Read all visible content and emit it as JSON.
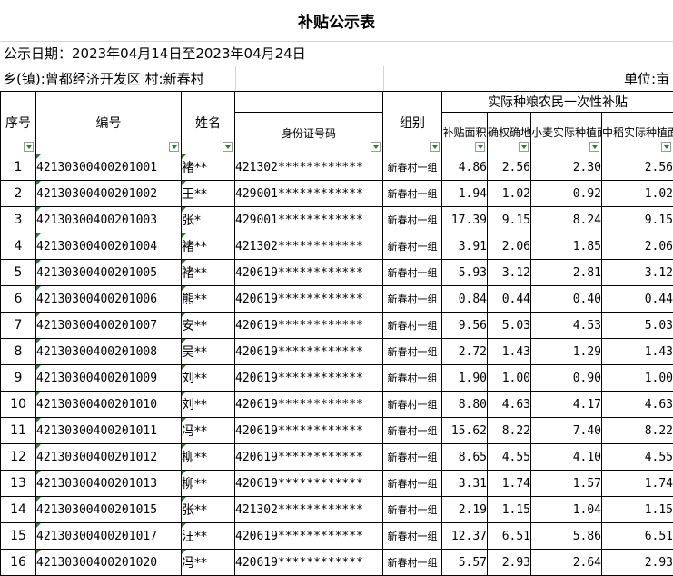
{
  "title": "补贴公示表",
  "publish_line": "公示日期：2023年04月14日至2023年04月24日",
  "location_line": "乡(镇):曾都经济开发区 村:新春村",
  "unit_line": "单位:亩",
  "headers": {
    "seq": "序号",
    "code": "编号",
    "name": "姓名",
    "id": "身份证号码",
    "group": "组别",
    "group_title": "实际种粮农民一次性补贴",
    "subsidy_area": "补贴面积",
    "confirmed_area": "确权确地实测面积",
    "wheat_area": "小麦实际种植面积",
    "rice_area": "中稻实际种植面积"
  },
  "rows": [
    {
      "seq": "1",
      "code": "42130300400201001",
      "name": "褚**",
      "id": "421302************",
      "group": "新春村一组",
      "subsidy": "4.86",
      "confirmed": "2.56",
      "wheat": "2.30",
      "rice": "2.56"
    },
    {
      "seq": "2",
      "code": "42130300400201002",
      "name": "王**",
      "id": "429001************",
      "group": "新春村一组",
      "subsidy": "1.94",
      "confirmed": "1.02",
      "wheat": "0.92",
      "rice": "1.02"
    },
    {
      "seq": "3",
      "code": "42130300400201003",
      "name": "张*",
      "id": "429001************",
      "group": "新春村一组",
      "subsidy": "17.39",
      "confirmed": "9.15",
      "wheat": "8.24",
      "rice": "9.15"
    },
    {
      "seq": "4",
      "code": "42130300400201004",
      "name": "褚**",
      "id": "421302************",
      "group": "新春村一组",
      "subsidy": "3.91",
      "confirmed": "2.06",
      "wheat": "1.85",
      "rice": "2.06"
    },
    {
      "seq": "5",
      "code": "42130300400201005",
      "name": "褚**",
      "id": "420619************",
      "group": "新春村一组",
      "subsidy": "5.93",
      "confirmed": "3.12",
      "wheat": "2.81",
      "rice": "3.12"
    },
    {
      "seq": "6",
      "code": "42130300400201006",
      "name": "熊**",
      "id": "420619************",
      "group": "新春村一组",
      "subsidy": "0.84",
      "confirmed": "0.44",
      "wheat": "0.40",
      "rice": "0.44"
    },
    {
      "seq": "7",
      "code": "42130300400201007",
      "name": "安**",
      "id": "420619************",
      "group": "新春村一组",
      "subsidy": "9.56",
      "confirmed": "5.03",
      "wheat": "4.53",
      "rice": "5.03"
    },
    {
      "seq": "8",
      "code": "42130300400201008",
      "name": "吴**",
      "id": "420619************",
      "group": "新春村一组",
      "subsidy": "2.72",
      "confirmed": "1.43",
      "wheat": "1.29",
      "rice": "1.43"
    },
    {
      "seq": "9",
      "code": "42130300400201009",
      "name": "刘**",
      "id": "420619************",
      "group": "新春村一组",
      "subsidy": "1.90",
      "confirmed": "1.00",
      "wheat": "0.90",
      "rice": "1.00"
    },
    {
      "seq": "10",
      "code": "42130300400201010",
      "name": "刘**",
      "id": "420619************",
      "group": "新春村一组",
      "subsidy": "8.80",
      "confirmed": "4.63",
      "wheat": "4.17",
      "rice": "4.63"
    },
    {
      "seq": "11",
      "code": "42130300400201011",
      "name": "冯**",
      "id": "420619************",
      "group": "新春村一组",
      "subsidy": "15.62",
      "confirmed": "8.22",
      "wheat": "7.40",
      "rice": "8.22"
    },
    {
      "seq": "12",
      "code": "42130300400201012",
      "name": "柳**",
      "id": "420619************",
      "group": "新春村一组",
      "subsidy": "8.65",
      "confirmed": "4.55",
      "wheat": "4.10",
      "rice": "4.55"
    },
    {
      "seq": "13",
      "code": "42130300400201013",
      "name": "柳**",
      "id": "420619************",
      "group": "新春村一组",
      "subsidy": "3.31",
      "confirmed": "1.74",
      "wheat": "1.57",
      "rice": "1.74"
    },
    {
      "seq": "14",
      "code": "42130300400201015",
      "name": "张**",
      "id": "421302************",
      "group": "新春村一组",
      "subsidy": "2.19",
      "confirmed": "1.15",
      "wheat": "1.04",
      "rice": "1.15"
    },
    {
      "seq": "15",
      "code": "42130300400201017",
      "name": "汪**",
      "id": "420619************",
      "group": "新春村一组",
      "subsidy": "12.37",
      "confirmed": "6.51",
      "wheat": "5.86",
      "rice": "6.51"
    },
    {
      "seq": "16",
      "code": "42130300400201020",
      "name": "冯**",
      "id": "420619************",
      "group": "新春村一组",
      "subsidy": "5.57",
      "confirmed": "2.93",
      "wheat": "2.64",
      "rice": "2.93"
    }
  ]
}
